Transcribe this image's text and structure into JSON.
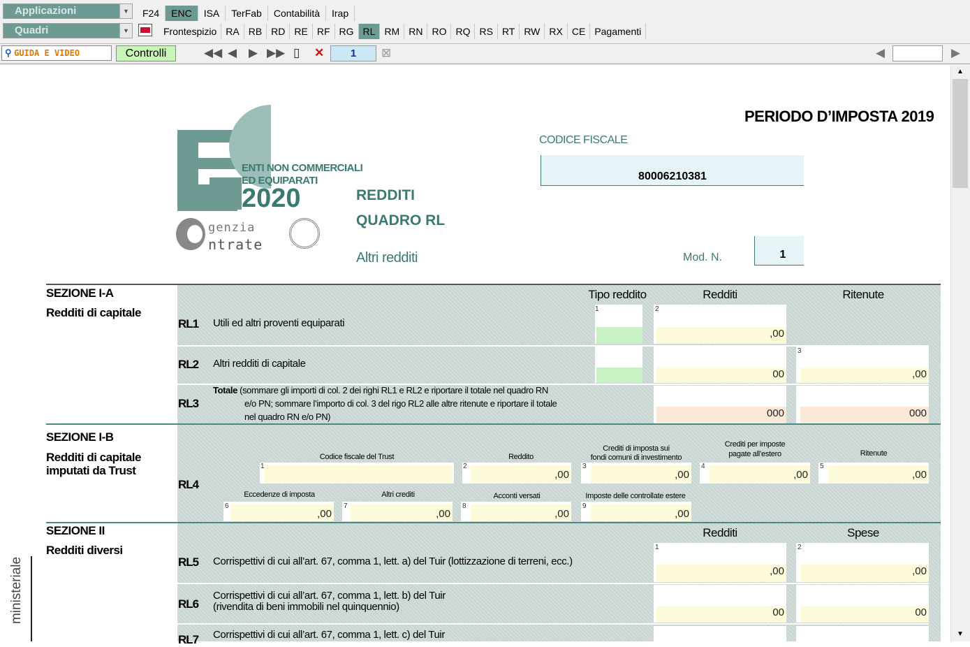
{
  "toolbar": {
    "applicazioni": "Applicazioni",
    "quadri": "Quadri",
    "app_tabs": [
      "F24",
      "ENC",
      "ISA",
      "TerFab",
      "Contabilità",
      "Irap"
    ],
    "quadri_tabs": [
      "Frontespizio",
      "RA",
      "RB",
      "RD",
      "RE",
      "RF",
      "RG",
      "RL",
      "RM",
      "RN",
      "RO",
      "RQ",
      "RS",
      "RT",
      "RW",
      "RX",
      "CE",
      "Pagamenti"
    ],
    "guida": "GUIDA E VIDEO",
    "controlli": "Controlli",
    "page_number": "1"
  },
  "header": {
    "periodo": "PERIODO D’IMPOSTA 2019",
    "codice_fiscale_label": "CODICE FISCALE",
    "codice_fiscale": "80006210381",
    "logo_l1": "ENTI NON COMMERCIALI",
    "logo_l2": "ED EQUIPARATI",
    "logo_year": "2020",
    "agenzia": "genzia",
    "entrate": "ntrate",
    "redditi": "REDDITI",
    "quadro": "QUADRO RL",
    "altri": "Altri redditi",
    "mod_label": "Mod. N.",
    "mod_value": "1"
  },
  "sections": {
    "s1a_title": "SEZIONE I-A",
    "s1a_sub": "Redditi di capitale",
    "s1b_title": "SEZIONE I-B",
    "s1b_sub1": "Redditi di capitale",
    "s1b_sub2": "imputati da Trust",
    "s2_title": "SEZIONE II",
    "s2_sub": "Redditi diversi",
    "side_label": "ministeriale"
  },
  "cols": {
    "tipo": "Tipo reddito",
    "redditi": "Redditi",
    "ritenute": "Ritenute",
    "spese": "Spese"
  },
  "rows": {
    "rl1_code": "RL1",
    "rl1_desc": "Utili ed altri proventi equiparati",
    "rl1_v2": ",00",
    "rl2_code": "RL2",
    "rl2_desc": "Altri redditi di capitale",
    "rl2_v2": "00",
    "rl2_v3": ",00",
    "rl3_code": "RL3",
    "rl3_bold": "Totale",
    "rl3_desc1": " (sommare gli importi di col. 2 dei righi RL1 e RL2 e riportare il totale nel quadro RN",
    "rl3_desc2": "e/o PN; sommare l’importo di col. 3 del rigo RL2 alle altre ritenute e riportare il totale",
    "rl3_desc3": "nel quadro RN e/o PN)",
    "rl3_v2": "0",
    "rl3_v2b": "00",
    "rl3_v3": "0",
    "rl3_v3b": "00",
    "rl4_code": "RL4",
    "rl4_h1": "Codice fiscale del Trust",
    "rl4_h2": "Reddito",
    "rl4_h3a": "Crediti di imposta sui",
    "rl4_h3b": "fondi comuni di investimento",
    "rl4_h4a": "Crediti per imposte",
    "rl4_h4b": "pagate all’estero",
    "rl4_h5": "Ritenute",
    "rl4_h6": "Eccedenze di imposta",
    "rl4_h7": "Altri crediti",
    "rl4_h8": "Acconti versati",
    "rl4_h9": "Imposte delle controllate estere",
    "rl4_v": ",00",
    "rl5_code": "RL5",
    "rl5_desc": "Corrispettivi di cui all’art. 67, comma 1, lett. a) del Tuir (lottizzazione di terreni, ecc.)",
    "rl5_v1": ",00",
    "rl5_v2": ",00",
    "rl6_code": "RL6",
    "rl6_desc1": "Corrispettivi di cui all’art. 67, comma 1, lett. b) del Tuir",
    "rl6_desc2": "(rivendita di beni immobili nel quinquennio)",
    "rl6_v1": "00",
    "rl6_v2": "00",
    "rl7_code": "RL7",
    "rl7_desc": "Corrispettivi di cui all’art. 67, comma 1, lett. c) del Tuir"
  }
}
